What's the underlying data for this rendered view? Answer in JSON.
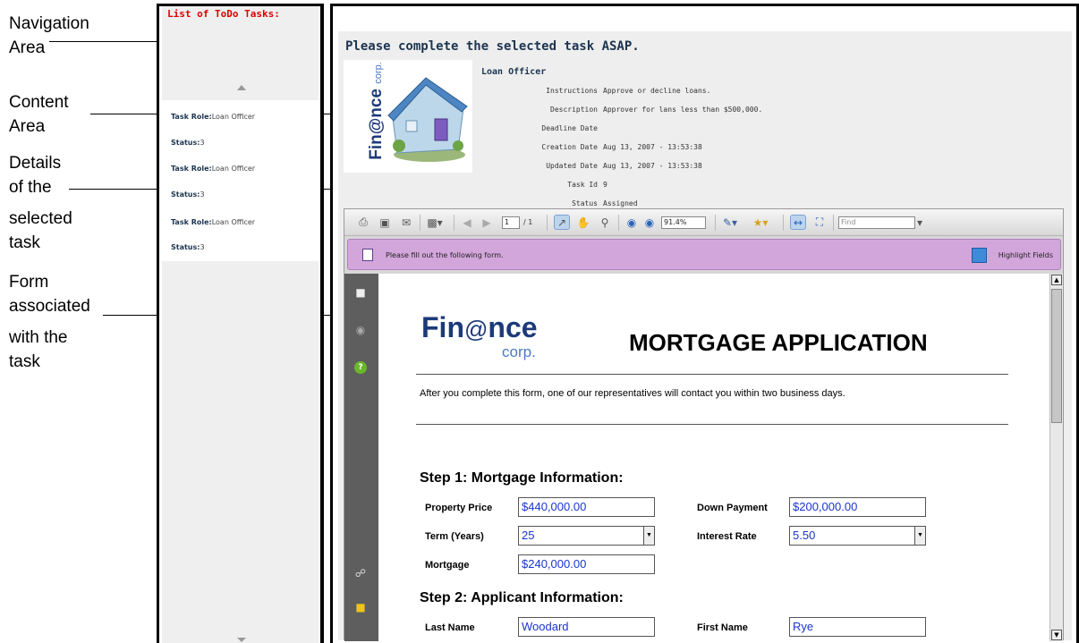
{
  "annotations": {
    "navigation_area": [
      "Navigation",
      "Area"
    ],
    "content_area": [
      "Content",
      "Area"
    ],
    "details": [
      "Details",
      "of the",
      "selected",
      "task"
    ],
    "form": [
      "Form",
      "associated",
      "with the",
      "task"
    ]
  },
  "nav": {
    "title": "List of ToDo Tasks:",
    "tasks": [
      {
        "role_label": "Task Role:",
        "role": "Loan Officer",
        "status_label": "Status:",
        "status": "3"
      },
      {
        "role_label": "Task Role:",
        "role": "Loan Officer",
        "status_label": "Status:",
        "status": "3"
      },
      {
        "role_label": "Task Role:",
        "role": "Loan Officer",
        "status_label": "Status:",
        "status": "3"
      }
    ]
  },
  "content": {
    "heading": "Please complete the selected task ASAP.",
    "logo": {
      "brand": "Fin@nce",
      "sub": "corp."
    },
    "role": "Loan Officer",
    "details": [
      {
        "label": "Instructions",
        "value": "Approve or decline loans."
      },
      {
        "label": "Description",
        "value": "Approver for lans less than $500,000."
      },
      {
        "label": "Deadline Date",
        "value": ""
      },
      {
        "label": "Creation Date",
        "value": "Aug 13, 2007 - 13:53:38"
      },
      {
        "label": "Updated Date",
        "value": "Aug 13, 2007 - 13:53:38"
      },
      {
        "label": "Task Id",
        "value": "9"
      },
      {
        "label": "Status",
        "value": "Assigned"
      }
    ]
  },
  "viewer": {
    "page_current": "1",
    "page_total": "/ 1",
    "zoom": "91.4%",
    "find_placeholder": "Find",
    "form_message": "Please fill out the following form.",
    "highlight_label": "Highlight Fields"
  },
  "form": {
    "brand": "Fin",
    "brand_at": "@",
    "brand_tail": "nce",
    "brand_sub": "corp.",
    "title": "MORTGAGE APPLICATION",
    "intro": "After you complete this form, one of our representatives will contact you within two business days.",
    "step1": "Step 1: Mortgage Information:",
    "property_price_label": "Property Price",
    "property_price": "$440,000.00",
    "down_payment_label": "Down Payment",
    "down_payment": "$200,000.00",
    "term_label": "Term (Years)",
    "term": "25",
    "interest_label": "Interest Rate",
    "interest": "5.50",
    "mortgage_label": "Mortgage",
    "mortgage": "$240,000.00",
    "step2": "Step 2: Applicant Information:",
    "last_name_label": "Last Name",
    "last_name": "Woodard",
    "first_name_label": "First Name",
    "first_name": "Rye"
  }
}
